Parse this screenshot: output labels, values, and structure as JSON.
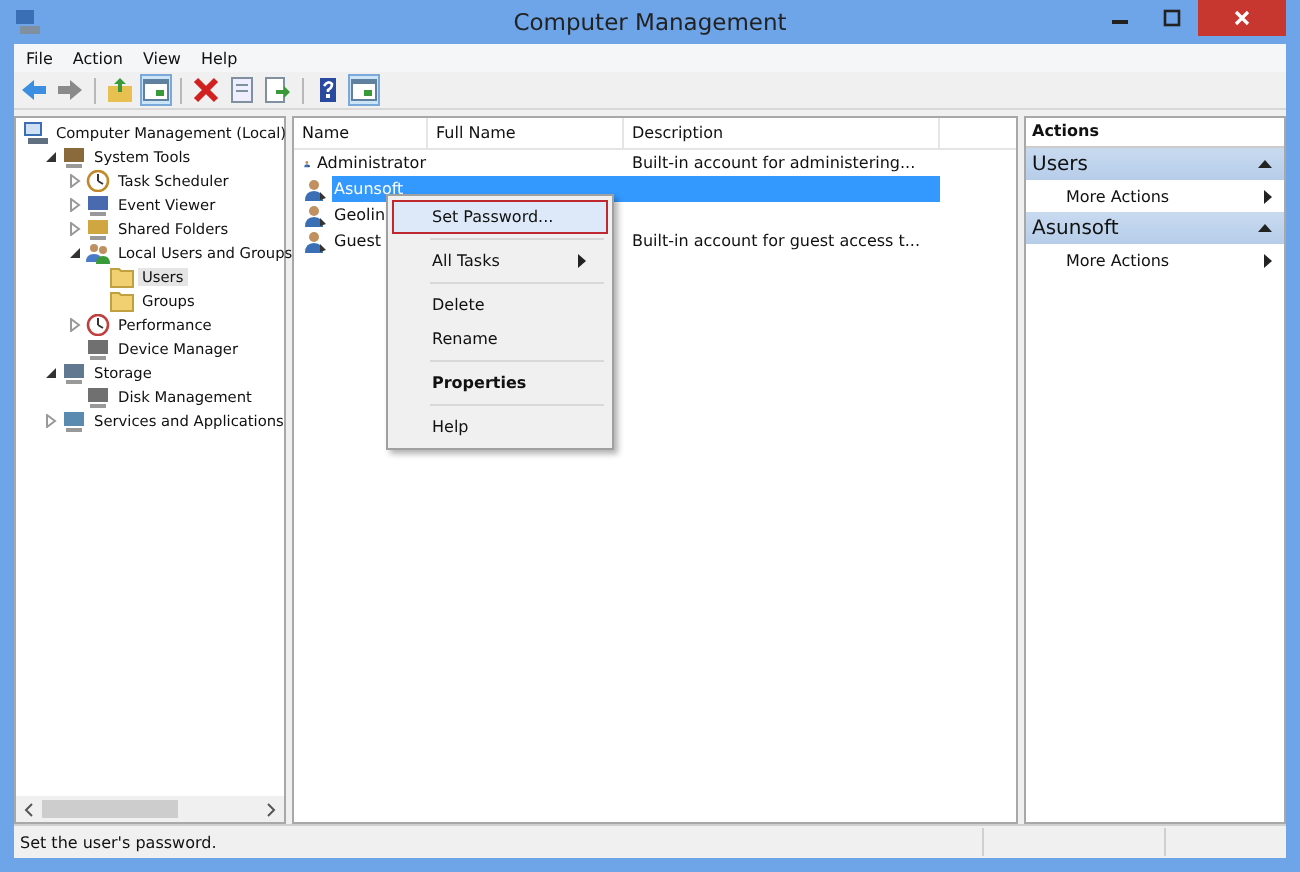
{
  "window": {
    "title": "Computer Management"
  },
  "menu": [
    "File",
    "Action",
    "View",
    "Help"
  ],
  "toolbar": [
    {
      "kind": "back",
      "pressed": false
    },
    {
      "kind": "forward",
      "pressed": false
    },
    {
      "kind": "sep"
    },
    {
      "kind": "up",
      "pressed": false
    },
    {
      "kind": "tree",
      "pressed": true
    },
    {
      "kind": "sep"
    },
    {
      "kind": "delete",
      "pressed": false
    },
    {
      "kind": "props",
      "pressed": false
    },
    {
      "kind": "export",
      "pressed": false
    },
    {
      "kind": "sep"
    },
    {
      "kind": "help",
      "pressed": false
    },
    {
      "kind": "pane",
      "pressed": true
    }
  ],
  "tree": [
    {
      "label": "Computer Management (Local)",
      "kind": "computer",
      "selected": false,
      "children": [
        {
          "label": "System Tools",
          "kind": "tools",
          "selected": false,
          "expanded": true,
          "children": [
            {
              "label": "Task Scheduler",
              "kind": "clock",
              "selected": false,
              "expanded": false
            },
            {
              "label": "Event Viewer",
              "kind": "log",
              "selected": false,
              "expanded": false
            },
            {
              "label": "Shared Folders",
              "kind": "share",
              "selected": false,
              "expanded": false
            },
            {
              "label": "Local Users and Groups",
              "kind": "users",
              "selected": false,
              "expanded": true,
              "children": [
                {
                  "label": "Users",
                  "kind": "folder",
                  "selected": true
                },
                {
                  "label": "Groups",
                  "kind": "folder",
                  "selected": false
                }
              ]
            },
            {
              "label": "Performance",
              "kind": "gauge",
              "selected": false,
              "expanded": false
            },
            {
              "label": "Device Manager",
              "kind": "device",
              "selected": false
            }
          ]
        },
        {
          "label": "Storage",
          "kind": "disk",
          "selected": false,
          "expanded": true,
          "children": [
            {
              "label": "Disk Management",
              "kind": "device",
              "selected": false
            }
          ]
        },
        {
          "label": "Services and Applications",
          "kind": "services",
          "selected": false,
          "expanded": false
        }
      ]
    }
  ],
  "table": {
    "columns": [
      "Name",
      "Full Name",
      "Description"
    ],
    "rows": [
      {
        "name": "Administrator",
        "full_name": "",
        "description": "Built-in account for administering...",
        "selected": false
      },
      {
        "name": "Asunsoft",
        "full_name": "",
        "description": "",
        "selected": true
      },
      {
        "name": "Geolin",
        "full_name": "",
        "description": "",
        "selected": false
      },
      {
        "name": "Guest",
        "full_name": "",
        "description": "Built-in account for guest access t...",
        "selected": false
      }
    ]
  },
  "context_menu": [
    {
      "kind": "item",
      "label": "Set Password...",
      "selected": true,
      "default": false
    },
    {
      "kind": "separator"
    },
    {
      "kind": "submenu",
      "label": "All Tasks",
      "selected": false,
      "default": false
    },
    {
      "kind": "separator"
    },
    {
      "kind": "item",
      "label": "Delete",
      "selected": false,
      "default": false
    },
    {
      "kind": "item",
      "label": "Rename",
      "selected": false,
      "default": false
    },
    {
      "kind": "separator"
    },
    {
      "kind": "item",
      "label": "Properties",
      "selected": false,
      "default": true
    },
    {
      "kind": "separator"
    },
    {
      "kind": "item",
      "label": "Help",
      "selected": false,
      "default": false
    }
  ],
  "actions": {
    "title": "Actions",
    "sections": [
      {
        "title": "Users",
        "items": [
          "More Actions"
        ]
      },
      {
        "title": "Asunsoft",
        "items": [
          "More Actions"
        ]
      }
    ]
  },
  "status_bar": "Set the user's password."
}
